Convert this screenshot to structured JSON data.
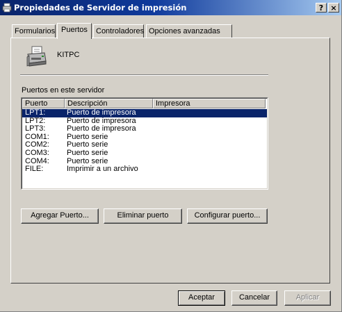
{
  "window": {
    "title": "Propiedades de Servidor de impresión",
    "help_button": "?",
    "close_button": "×"
  },
  "tabs": [
    {
      "label": "Formularios",
      "active": false
    },
    {
      "label": "Puertos",
      "active": true
    },
    {
      "label": "Controladores",
      "active": false
    },
    {
      "label": "Opciones avanzadas",
      "active": false
    }
  ],
  "server": {
    "name": "KITPC",
    "icon": "printer-server-icon"
  },
  "ports_section": {
    "label": "Puertos en este servidor",
    "columns": [
      "Puerto",
      "Descripción",
      "Impresora"
    ],
    "rows": [
      {
        "port": "LPT1:",
        "description": "Puerto de impresora",
        "printer": "",
        "selected": true
      },
      {
        "port": "LPT2:",
        "description": "Puerto de impresora",
        "printer": "",
        "selected": false
      },
      {
        "port": "LPT3:",
        "description": "Puerto de impresora",
        "printer": "",
        "selected": false
      },
      {
        "port": "COM1:",
        "description": "Puerto serie",
        "printer": "",
        "selected": false
      },
      {
        "port": "COM2:",
        "description": "Puerto serie",
        "printer": "",
        "selected": false
      },
      {
        "port": "COM3:",
        "description": "Puerto serie",
        "printer": "",
        "selected": false
      },
      {
        "port": "COM4:",
        "description": "Puerto serie",
        "printer": "",
        "selected": false
      },
      {
        "port": "FILE:",
        "description": "Imprimir a un archivo",
        "printer": "",
        "selected": false
      }
    ]
  },
  "port_buttons": {
    "add": "Agregar Puerto...",
    "delete": "Eliminar puerto",
    "configure": "Configurar puerto..."
  },
  "dialog_buttons": {
    "ok": "Aceptar",
    "cancel": "Cancelar",
    "apply": "Aplicar",
    "apply_enabled": false
  },
  "colors": {
    "titlebar_start": "#0a246a",
    "titlebar_end": "#a6caf0",
    "selection": "#0a246a",
    "face": "#d4d0c8"
  }
}
